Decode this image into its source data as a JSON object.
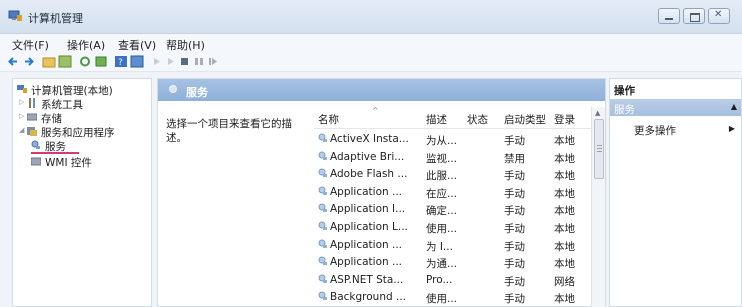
{
  "window": {
    "title": "计算机管理"
  },
  "menu": [
    "文件(F)",
    "操作(A)",
    "查看(V)",
    "帮助(H)"
  ],
  "tree": {
    "items": [
      {
        "label": "计算机管理(本地)"
      },
      {
        "label": "系统工具"
      },
      {
        "label": "存储"
      },
      {
        "label": "服务和应用程序"
      },
      {
        "label": "服务"
      },
      {
        "label": "WMI 控件"
      }
    ]
  },
  "main": {
    "header_title": "服务",
    "description": "选择一个项目来查看它的描述。",
    "columns": {
      "name": "名称",
      "desc": "描述",
      "status": "状态",
      "startup": "启动类型",
      "login": "登录"
    },
    "rows": [
      {
        "name": "ActiveX Insta...",
        "desc": "为从...",
        "status": "",
        "startup": "手动",
        "login": "本地"
      },
      {
        "name": "Adaptive Bri...",
        "desc": "监视...",
        "status": "",
        "startup": "禁用",
        "login": "本地"
      },
      {
        "name": "Adobe Flash ...",
        "desc": "此服...",
        "status": "",
        "startup": "手动",
        "login": "本地"
      },
      {
        "name": "Application ...",
        "desc": "在应...",
        "status": "",
        "startup": "手动",
        "login": "本地"
      },
      {
        "name": "Application I...",
        "desc": "确定...",
        "status": "",
        "startup": "手动",
        "login": "本地"
      },
      {
        "name": "Application L...",
        "desc": "使用...",
        "status": "",
        "startup": "手动",
        "login": "本地"
      },
      {
        "name": "Application ...",
        "desc": "为 I...",
        "status": "",
        "startup": "手动",
        "login": "本地"
      },
      {
        "name": "Application ...",
        "desc": "为通...",
        "status": "",
        "startup": "手动",
        "login": "本地"
      },
      {
        "name": "ASP.NET Sta...",
        "desc": "Pro...",
        "status": "",
        "startup": "手动",
        "login": "网络"
      },
      {
        "name": "Background ...",
        "desc": "使用...",
        "status": "",
        "startup": "手动",
        "login": "本地"
      }
    ]
  },
  "actions": {
    "title": "操作",
    "section": "服务",
    "more": "更多操作"
  }
}
